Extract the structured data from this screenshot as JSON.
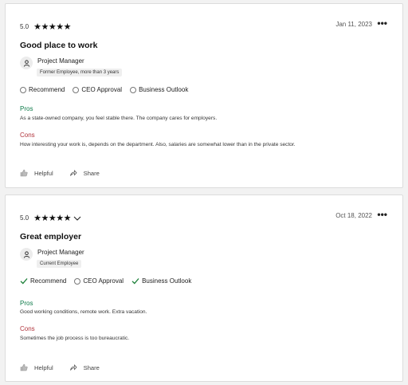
{
  "colors": {
    "pros": "#0f7b4a",
    "cons": "#b1353d",
    "check": "#1a7f37"
  },
  "reviews": [
    {
      "rating": "5.0",
      "stars": "★★★★★",
      "show_chevron": false,
      "date": "Jan 11, 2023",
      "more": "•••",
      "title": "Good place to work",
      "role": "Project Manager",
      "tag": "Former Employee, more than 3 years",
      "recommend": {
        "label": "Recommend",
        "state": "neutral"
      },
      "ceo": {
        "label": "CEO Approval",
        "state": "neutral"
      },
      "outlook": {
        "label": "Business Outlook",
        "state": "neutral"
      },
      "pros_label": "Pros",
      "pros": "As a state-owned company, you feel stable there. The company cares for employers.",
      "cons_label": "Cons",
      "cons": "How interesting your work is, depends on the department. Also, salaries are somewhat lower than in the private sector.",
      "helpful": "Helpful",
      "share": "Share"
    },
    {
      "rating": "5.0",
      "stars": "★★★★★",
      "show_chevron": true,
      "date": "Oct 18, 2022",
      "more": "•••",
      "title": "Great employer",
      "role": "Project Manager",
      "tag": "Current Employee",
      "recommend": {
        "label": "Recommend",
        "state": "positive"
      },
      "ceo": {
        "label": "CEO Approval",
        "state": "neutral"
      },
      "outlook": {
        "label": "Business Outlook",
        "state": "positive"
      },
      "pros_label": "Pros",
      "pros": "Good working conditions, remote work. Extra vacation.",
      "cons_label": "Cons",
      "cons": "Sometimes the job process is too bureaucratic.",
      "helpful": "Helpful",
      "share": "Share"
    }
  ]
}
